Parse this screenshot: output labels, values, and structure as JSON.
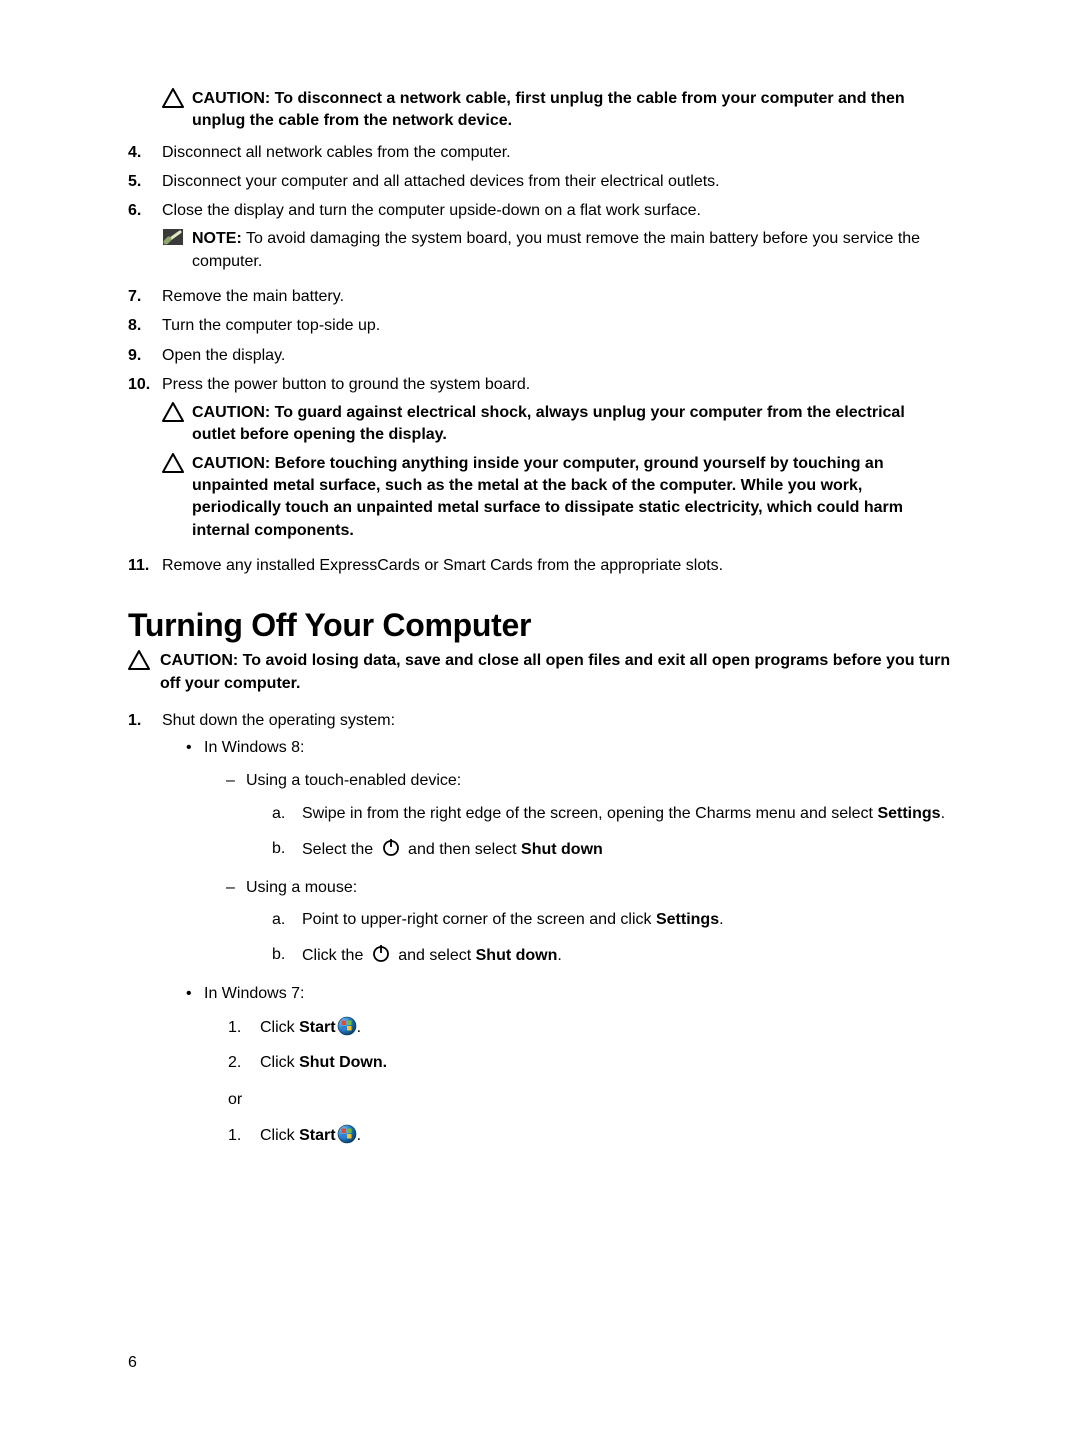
{
  "page_number": "6",
  "caution_label": "CAUTION:",
  "note_label": "NOTE:",
  "caution_net_cable": "To disconnect a network cable, first unplug the cable from your computer and then unplug the cable from the network device.",
  "steps": {
    "s4": {
      "n": "4.",
      "t": "Disconnect all network cables from the computer."
    },
    "s5": {
      "n": "5.",
      "t": "Disconnect your computer and all attached devices from their electrical outlets."
    },
    "s6": {
      "n": "6.",
      "t": "Close the display and turn the computer upside-down on a flat work surface."
    },
    "note6": "To avoid damaging the system board, you must remove the main battery before you service the computer.",
    "s7": {
      "n": "7.",
      "t": "Remove the main battery."
    },
    "s8": {
      "n": "8.",
      "t": "Turn the computer top-side up."
    },
    "s9": {
      "n": "9.",
      "t": "Open the display."
    },
    "s10": {
      "n": "10.",
      "t": "Press the power button to ground the system board."
    },
    "caution10a": "To guard against electrical shock, always unplug your computer from the electrical outlet before opening the display.",
    "caution10b": "Before touching anything inside your computer, ground yourself by touching an unpainted metal surface, such as the metal at the back of the computer. While you work, periodically touch an unpainted metal surface to dissipate static electricity, which could harm internal components.",
    "s11": {
      "n": "11.",
      "t": "Remove any installed ExpressCards or Smart Cards from the appropriate slots."
    }
  },
  "section_title": "Turning Off Your Computer",
  "caution_shutdown": "To avoid losing data, save and close all open files and exit all open programs before you turn off your computer.",
  "shutdown": {
    "n": "1.",
    "lead": "Shut down the operating system:",
    "win8_label": "In Windows 8:",
    "touch_label": "Using a touch-enabled device:",
    "touch_a_pre": "Swipe in from the right edge of the screen, opening the Charms menu and select ",
    "settings_word": "Settings",
    "period": ".",
    "touch_b_pre": "Select the ",
    "touch_b_post": " and then select ",
    "shut_down_word": "Shut down",
    "mouse_label": "Using a mouse:",
    "mouse_a_pre": "Point to upper-right corner of the screen and click ",
    "mouse_b_pre": "Click the ",
    "mouse_b_post": " and select ",
    "win7_label": "In Windows 7:",
    "click_word": "Click ",
    "start_word": "Start",
    "shut_down_period": "Shut Down.",
    "or_word": "or",
    "letters": {
      "a": "a.",
      "b": "b."
    },
    "nums": {
      "one": "1.",
      "two": "2."
    }
  }
}
